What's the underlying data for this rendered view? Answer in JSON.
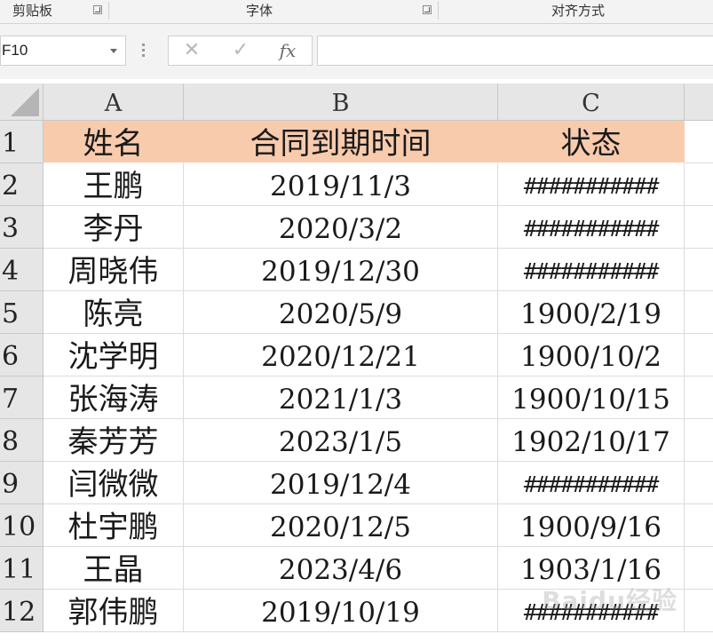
{
  "ribbon": {
    "groups": [
      "剪贴板",
      "字体",
      "对齐方式"
    ]
  },
  "formula_bar": {
    "name_box": "F10",
    "cancel_icon": "✕",
    "enter_icon": "✓",
    "fx_label": "fx",
    "formula": ""
  },
  "sheet": {
    "columns": [
      "A",
      "B",
      "C"
    ],
    "rows": [
      {
        "num": "1",
        "a": "姓名",
        "b": "合同到期时间",
        "c": "状态"
      },
      {
        "num": "2",
        "a": "王鹏",
        "b": "2019/11/3",
        "c": "###########"
      },
      {
        "num": "3",
        "a": "李丹",
        "b": "2020/3/2",
        "c": "###########"
      },
      {
        "num": "4",
        "a": "周晓伟",
        "b": "2019/12/30",
        "c": "###########"
      },
      {
        "num": "5",
        "a": "陈亮",
        "b": "2020/5/9",
        "c": "1900/2/19"
      },
      {
        "num": "6",
        "a": "沈学明",
        "b": "2020/12/21",
        "c": "1900/10/2"
      },
      {
        "num": "7",
        "a": "张海涛",
        "b": "2021/1/3",
        "c": "1900/10/15"
      },
      {
        "num": "8",
        "a": "秦芳芳",
        "b": "2023/1/5",
        "c": "1902/10/17"
      },
      {
        "num": "9",
        "a": "闫微微",
        "b": "2019/12/4",
        "c": "###########"
      },
      {
        "num": "10",
        "a": "杜宇鹏",
        "b": "2020/12/5",
        "c": "1900/9/16"
      },
      {
        "num": "11",
        "a": "王晶",
        "b": "2023/4/6",
        "c": "1903/1/16"
      },
      {
        "num": "12",
        "a": "郭伟鹏",
        "b": "2019/10/19",
        "c": "###########"
      }
    ],
    "header_fill": "#f8cbad"
  },
  "watermark": "Baidu经验"
}
